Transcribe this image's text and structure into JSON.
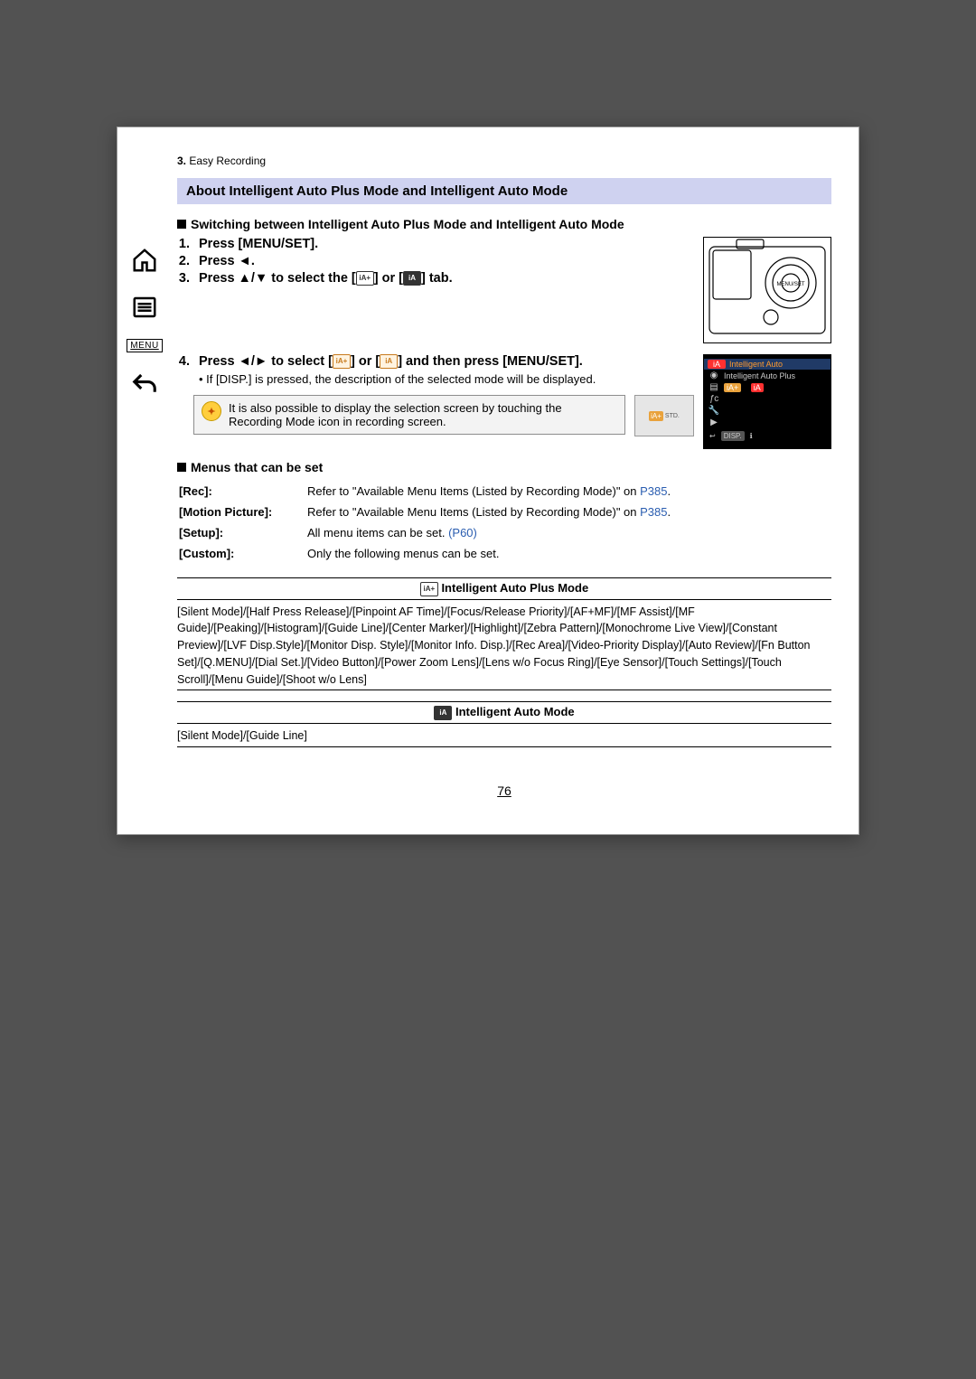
{
  "breadcrumb": {
    "num": "3.",
    "label": "Easy Recording"
  },
  "sidebar": {
    "menu_label": "MENU"
  },
  "section_title": "About Intelligent Auto Plus Mode and Intelligent Auto Mode",
  "sub_switching": "Switching between Intelligent Auto Plus Mode and Intelligent Auto Mode",
  "steps": {
    "s1": "Press [MENU/SET].",
    "s2": "Press ◄.",
    "s3_a": "Press ▲/▼ to select the [",
    "s3_icon1": "iA+",
    "s3_b": "] or [",
    "s3_icon2": "iA",
    "s3_c": "] tab.",
    "s4_a": "Press ◄/► to select [",
    "s4_icon1": "iA+",
    "s4_b": "] or [",
    "s4_icon2": "iA",
    "s4_c": "] and then press [MENU/SET].",
    "s4_note": "If [DISP.] is pressed, the description of the selected mode will be displayed."
  },
  "cam_menu": {
    "title": "Intelligent Auto",
    "row2": "Intelligent Auto Plus",
    "ia": "iA",
    "iap": "iA+",
    "disp": "DISP."
  },
  "tip": {
    "text": "It is also possible to display the selection screen by touching the Recording Mode icon in recording screen.",
    "thumb_label": "STD."
  },
  "menus_heading": "Menus that can be set",
  "menus": {
    "rec_k": "[Rec]:",
    "rec_v_a": "Refer to \"Available Menu Items (Listed by Recording Mode)\" on ",
    "rec_v_link": "P385",
    "rec_v_b": ".",
    "mp_k": "[Motion Picture]:",
    "mp_v_a": "Refer to \"Available Menu Items (Listed by Recording Mode)\" on ",
    "mp_v_link": "P385",
    "mp_v_b": ".",
    "setup_k": "[Setup]:",
    "setup_v_a": "All menu items can be set. ",
    "setup_v_link": "(P60)",
    "custom_k": "[Custom]:",
    "custom_v": "Only the following menus can be set."
  },
  "mode_plus_title": "Intelligent Auto Plus Mode",
  "mode_plus_body": "[Silent Mode]/[Half Press Release]/[Pinpoint AF Time]/[Focus/Release Priority]/[AF+MF]/[MF Assist]/[MF Guide]/[Peaking]/[Histogram]/[Guide Line]/[Center Marker]/[Highlight]/[Zebra Pattern]/[Monochrome Live View]/[Constant Preview]/[LVF Disp.Style]/[Monitor Disp. Style]/[Monitor Info. Disp.]/[Rec Area]/[Video-Priority Display]/[Auto Review]/[Fn Button Set]/[Q.MENU]/[Dial Set.]/[Video Button]/[Power Zoom Lens]/[Lens w/o Focus Ring]/[Eye Sensor]/[Touch Settings]/[Touch Scroll]/[Menu Guide]/[Shoot w/o Lens]",
  "mode_auto_title": "Intelligent Auto Mode",
  "mode_auto_body": "[Silent Mode]/[Guide Line]",
  "page_number": "76"
}
